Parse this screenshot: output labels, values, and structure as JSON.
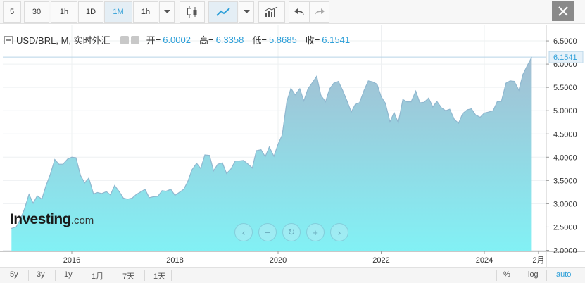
{
  "toolbar": {
    "buttons": [
      "5",
      "30",
      "1h",
      "1D",
      "1M",
      "1h"
    ],
    "active_button": "1M",
    "icons": [
      "chevron-down-icon",
      "candlestick-icon",
      "line-chart-icon",
      "chevron-down-icon",
      "indicator-icon",
      "undo-icon",
      "redo-icon",
      "close-icon"
    ]
  },
  "legend": {
    "symbol": "USD/BRL, M, 实时外汇",
    "open_label": "开=",
    "open": "6.0002",
    "high_label": "高=",
    "high": "6.3358",
    "low_label": "低=",
    "low": "5.8685",
    "close_label": "收=",
    "close": "6.1541"
  },
  "watermark": {
    "brand": "Investing",
    "suffix": ".com"
  },
  "bottombar": {
    "ranges": [
      "5y",
      "3y",
      "1y",
      "1月",
      "7天",
      "1天"
    ],
    "options": [
      "%",
      "log",
      "auto"
    ],
    "active_option": "auto"
  },
  "colors": {
    "accent": "#2d9fd8",
    "area_top": "#a4bed2",
    "area_bottom": "#82f1f5",
    "line": "#8fb7cf"
  },
  "chart_data": {
    "type": "area",
    "title": "USD/BRL, M, 实时外汇",
    "xlabel": "",
    "ylabel": "",
    "x_ticks": [
      "2016",
      "2018",
      "2020",
      "2022",
      "2024",
      "2月"
    ],
    "y_ticks": [
      "2.0000",
      "2.5000",
      "3.0000",
      "3.5000",
      "4.0000",
      "4.5000",
      "5.0000",
      "5.5000",
      "6.0000",
      "6.5000"
    ],
    "ylim": [
      2.0,
      6.6
    ],
    "last_value_label": "6.1541",
    "grid": true,
    "series": [
      {
        "values": [
          [
            2014.83,
            2.47
          ],
          [
            2014.92,
            2.5
          ],
          [
            2015.0,
            2.66
          ],
          [
            2015.08,
            2.88
          ],
          [
            2015.17,
            3.2
          ],
          [
            2015.25,
            3.01
          ],
          [
            2015.33,
            3.17
          ],
          [
            2015.42,
            3.1
          ],
          [
            2015.5,
            3.39
          ],
          [
            2015.58,
            3.62
          ],
          [
            2015.67,
            3.95
          ],
          [
            2015.75,
            3.85
          ],
          [
            2015.83,
            3.85
          ],
          [
            2015.92,
            3.96
          ],
          [
            2016.0,
            4.0
          ],
          [
            2016.08,
            3.99
          ],
          [
            2016.17,
            3.6
          ],
          [
            2016.25,
            3.45
          ],
          [
            2016.33,
            3.55
          ],
          [
            2016.42,
            3.21
          ],
          [
            2016.5,
            3.24
          ],
          [
            2016.58,
            3.22
          ],
          [
            2016.67,
            3.26
          ],
          [
            2016.75,
            3.19
          ],
          [
            2016.83,
            3.39
          ],
          [
            2016.92,
            3.26
          ],
          [
            2017.0,
            3.12
          ],
          [
            2017.08,
            3.1
          ],
          [
            2017.17,
            3.12
          ],
          [
            2017.25,
            3.2
          ],
          [
            2017.33,
            3.25
          ],
          [
            2017.42,
            3.31
          ],
          [
            2017.5,
            3.13
          ],
          [
            2017.58,
            3.15
          ],
          [
            2017.67,
            3.16
          ],
          [
            2017.75,
            3.28
          ],
          [
            2017.83,
            3.27
          ],
          [
            2017.92,
            3.31
          ],
          [
            2018.0,
            3.18
          ],
          [
            2018.08,
            3.24
          ],
          [
            2018.17,
            3.31
          ],
          [
            2018.25,
            3.48
          ],
          [
            2018.33,
            3.73
          ],
          [
            2018.42,
            3.87
          ],
          [
            2018.5,
            3.76
          ],
          [
            2018.58,
            4.05
          ],
          [
            2018.67,
            4.04
          ],
          [
            2018.75,
            3.71
          ],
          [
            2018.83,
            3.85
          ],
          [
            2018.92,
            3.88
          ],
          [
            2019.0,
            3.65
          ],
          [
            2019.08,
            3.74
          ],
          [
            2019.17,
            3.92
          ],
          [
            2019.25,
            3.92
          ],
          [
            2019.33,
            3.93
          ],
          [
            2019.42,
            3.85
          ],
          [
            2019.5,
            3.77
          ],
          [
            2019.58,
            4.14
          ],
          [
            2019.67,
            4.16
          ],
          [
            2019.75,
            4.01
          ],
          [
            2019.83,
            4.22
          ],
          [
            2019.92,
            4.02
          ],
          [
            2020.0,
            4.28
          ],
          [
            2020.08,
            4.48
          ],
          [
            2020.17,
            5.2
          ],
          [
            2020.25,
            5.48
          ],
          [
            2020.33,
            5.34
          ],
          [
            2020.42,
            5.47
          ],
          [
            2020.5,
            5.21
          ],
          [
            2020.58,
            5.47
          ],
          [
            2020.67,
            5.61
          ],
          [
            2020.75,
            5.74
          ],
          [
            2020.83,
            5.33
          ],
          [
            2020.92,
            5.19
          ],
          [
            2021.0,
            5.47
          ],
          [
            2021.08,
            5.59
          ],
          [
            2021.17,
            5.63
          ],
          [
            2021.25,
            5.44
          ],
          [
            2021.33,
            5.23
          ],
          [
            2021.42,
            4.97
          ],
          [
            2021.5,
            5.14
          ],
          [
            2021.58,
            5.17
          ],
          [
            2021.67,
            5.44
          ],
          [
            2021.75,
            5.64
          ],
          [
            2021.83,
            5.62
          ],
          [
            2021.92,
            5.57
          ],
          [
            2022.0,
            5.3
          ],
          [
            2022.08,
            5.16
          ],
          [
            2022.17,
            4.76
          ],
          [
            2022.25,
            4.96
          ],
          [
            2022.33,
            4.74
          ],
          [
            2022.42,
            5.24
          ],
          [
            2022.5,
            5.19
          ],
          [
            2022.58,
            5.19
          ],
          [
            2022.67,
            5.42
          ],
          [
            2022.75,
            5.17
          ],
          [
            2022.83,
            5.18
          ],
          [
            2022.92,
            5.27
          ],
          [
            2023.0,
            5.08
          ],
          [
            2023.08,
            5.2
          ],
          [
            2023.17,
            5.06
          ],
          [
            2023.25,
            5.0
          ],
          [
            2023.33,
            5.03
          ],
          [
            2023.42,
            4.81
          ],
          [
            2023.5,
            4.73
          ],
          [
            2023.58,
            4.94
          ],
          [
            2023.67,
            5.02
          ],
          [
            2023.75,
            5.04
          ],
          [
            2023.83,
            4.91
          ],
          [
            2023.92,
            4.86
          ],
          [
            2024.0,
            4.95
          ],
          [
            2024.08,
            4.97
          ],
          [
            2024.17,
            5.0
          ],
          [
            2024.25,
            5.19
          ],
          [
            2024.33,
            5.2
          ],
          [
            2024.42,
            5.59
          ],
          [
            2024.5,
            5.64
          ],
          [
            2024.58,
            5.63
          ],
          [
            2024.67,
            5.44
          ],
          [
            2024.75,
            5.78
          ],
          [
            2024.83,
            5.96
          ],
          [
            2024.92,
            6.15
          ]
        ]
      }
    ]
  }
}
